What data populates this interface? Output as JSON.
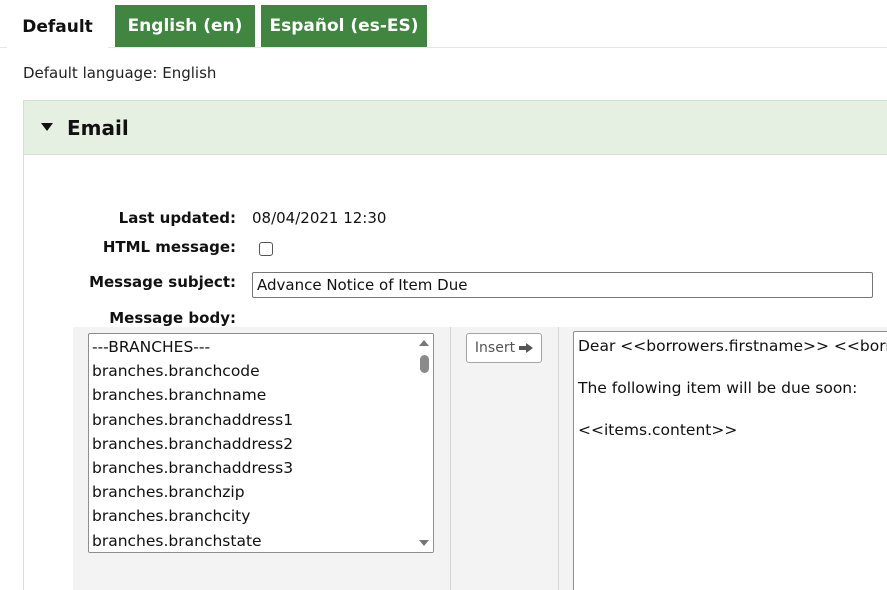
{
  "tabs": [
    {
      "label": "Default",
      "active": true
    },
    {
      "label": "English (en)",
      "active": false
    },
    {
      "label": "Español (es-ES)",
      "active": false
    }
  ],
  "default_language": {
    "label": "Default language:",
    "value": "English"
  },
  "panel": {
    "title": "Email",
    "last_updated": {
      "label": "Last updated:",
      "value": "08/04/2021 12:30"
    },
    "html_message": {
      "label": "HTML message:",
      "checked": false
    },
    "subject": {
      "label": "Message subject:",
      "value": "Advance Notice of Item Due"
    },
    "body": {
      "label": "Message body:",
      "fields": [
        "---BRANCHES---",
        "branches.branchcode",
        "branches.branchname",
        "branches.branchaddress1",
        "branches.branchaddress2",
        "branches.branchaddress3",
        "branches.branchzip",
        "branches.branchcity",
        "branches.branchstate"
      ],
      "insert_label": "Insert",
      "lines": [
        "Dear <<borrowers.firstname>> <<borro",
        "The following item will be due soon:",
        "<<items.content>>"
      ]
    }
  },
  "colors": {
    "tab_green": "#408540",
    "panel_header": "#e6f0e2"
  }
}
